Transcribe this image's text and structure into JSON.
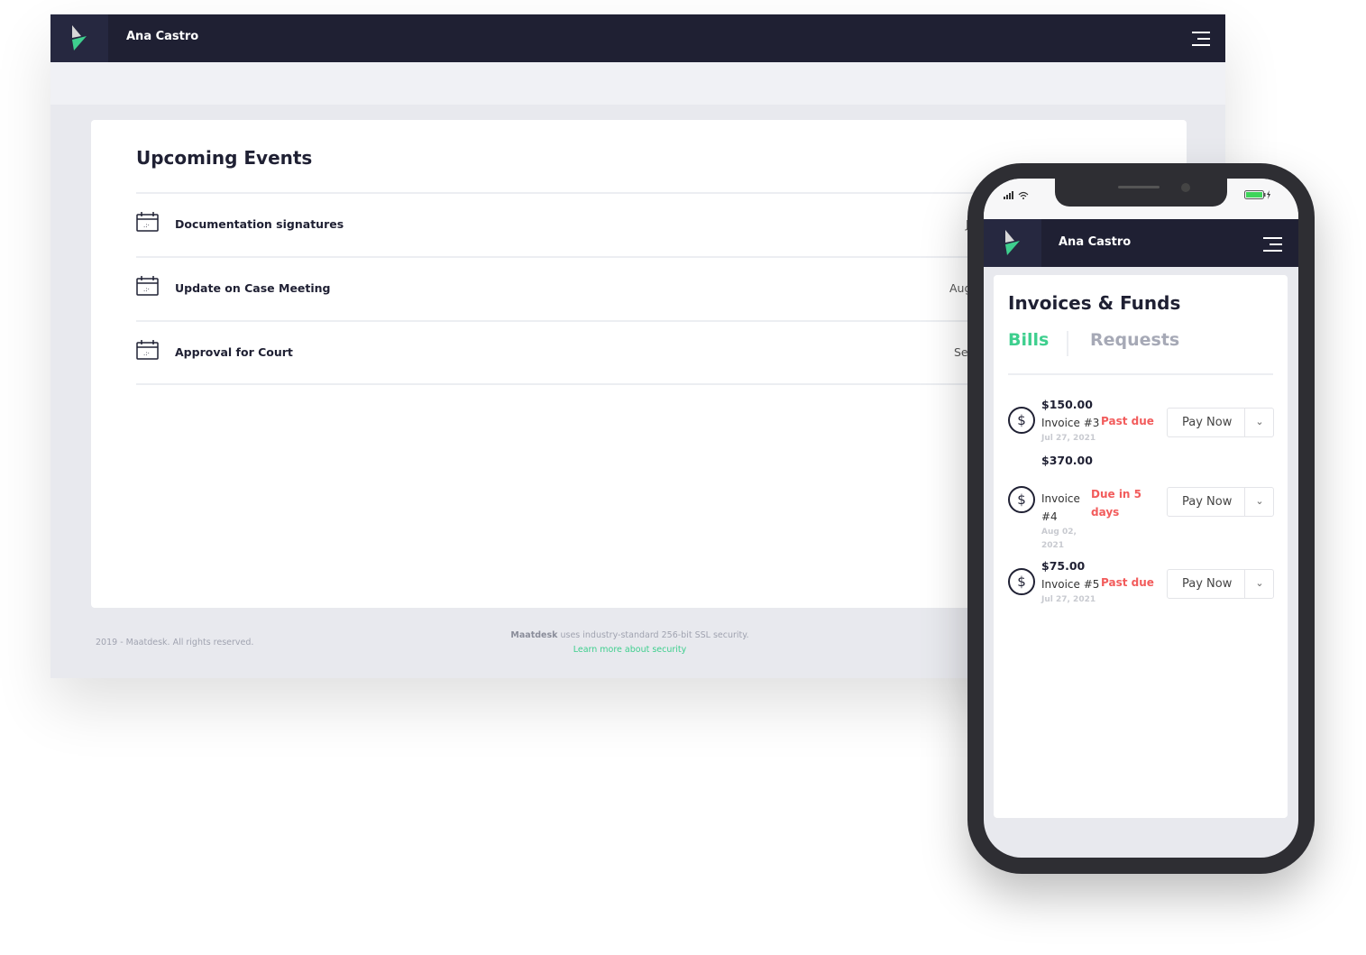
{
  "desktop": {
    "user_name": "Ana Castro",
    "events_title": "Upcoming Events",
    "events": [
      {
        "label": "Documentation signatures",
        "date_fragment": "J"
      },
      {
        "label": "Update on Case Meeting",
        "date_fragment": "Aug"
      },
      {
        "label": "Approval for Court",
        "date_fragment": "Se"
      }
    ],
    "footer": {
      "copyright": "2019 - Maatdesk. All rights reserved.",
      "brand": "Maatdesk",
      "security_text": " uses industry-standard 256-bit SSL security.",
      "security_link": "Learn more about security"
    }
  },
  "mobile": {
    "user_name": "Ana Castro",
    "title": "Invoices & Funds",
    "tabs": [
      {
        "label": "Bills",
        "active": true
      },
      {
        "label": "Requests",
        "active": false
      }
    ],
    "invoices": [
      {
        "amount": "$150.00",
        "number": "Invoice #3",
        "status": "Past due",
        "date": "Jul 27, 2021",
        "action": "Pay Now"
      },
      {
        "amount": "$370.00",
        "number": "Invoice #4",
        "status": "Due in 5 days",
        "date": "Aug 02, 2021",
        "action": "Pay Now"
      },
      {
        "amount": "$75.00",
        "number": "Invoice #5",
        "status": "Past due",
        "date": "Jul 27, 2021",
        "action": "Pay Now"
      }
    ]
  },
  "colors": {
    "navy": "#1f2033",
    "accent_green": "#3ecf8e",
    "danger": "#f25c5c"
  }
}
